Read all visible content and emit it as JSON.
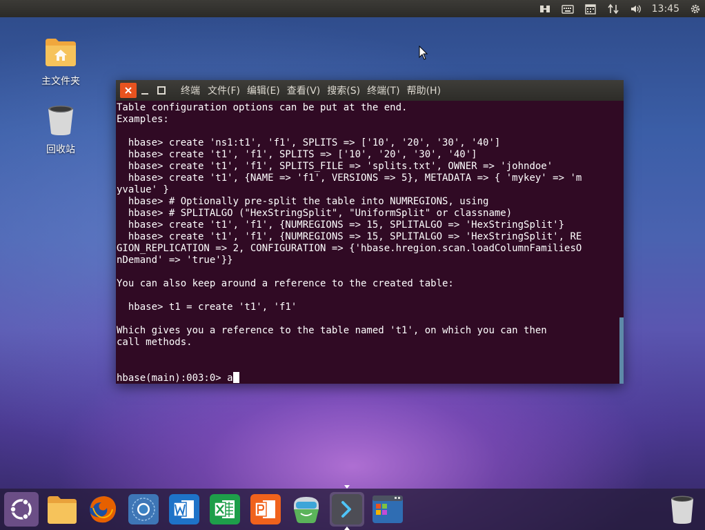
{
  "topbar": {
    "tray_icons": [
      "network-icon",
      "keyboard-icon",
      "calendar-icon",
      "transfer-icon",
      "volume-icon"
    ],
    "clock": "13:45",
    "power_icon": "gear-power-icon"
  },
  "desktop": {
    "icons": [
      {
        "name": "home-folder",
        "label": "主文件夹",
        "icon": "home-folder-icon"
      },
      {
        "name": "trash",
        "label": "回收站",
        "icon": "trash-icon"
      }
    ]
  },
  "terminal": {
    "title": "终端",
    "menus": [
      "文件(F)",
      "编辑(E)",
      "查看(V)",
      "搜索(S)",
      "终端(T)",
      "帮助(H)"
    ],
    "lines": [
      "Table configuration options can be put at the end.",
      "Examples:",
      "",
      "  hbase> create 'ns1:t1', 'f1', SPLITS => ['10', '20', '30', '40']",
      "  hbase> create 't1', 'f1', SPLITS => ['10', '20', '30', '40']",
      "  hbase> create 't1', 'f1', SPLITS_FILE => 'splits.txt', OWNER => 'johndoe'",
      "  hbase> create 't1', {NAME => 'f1', VERSIONS => 5}, METADATA => { 'mykey' => 'm",
      "yvalue' }",
      "  hbase> # Optionally pre-split the table into NUMREGIONS, using",
      "  hbase> # SPLITALGO (\"HexStringSplit\", \"UniformSplit\" or classname)",
      "  hbase> create 't1', 'f1', {NUMREGIONS => 15, SPLITALGO => 'HexStringSplit'}",
      "  hbase> create 't1', 'f1', {NUMREGIONS => 15, SPLITALGO => 'HexStringSplit', RE",
      "GION_REPLICATION => 2, CONFIGURATION => {'hbase.hregion.scan.loadColumnFamiliesO",
      "nDemand' => 'true'}}",
      "",
      "You can also keep around a reference to the created table:",
      "",
      "  hbase> t1 = create 't1', 'f1'",
      "",
      "Which gives you a reference to the table named 't1', on which you can then",
      "call methods.",
      "",
      ""
    ],
    "prompt": "hbase(main):003:0> ",
    "input": "a"
  },
  "dock": {
    "items": [
      {
        "name": "ubuntu-launcher",
        "icon": "ubuntu-logo-icon"
      },
      {
        "name": "files",
        "icon": "folder-icon"
      },
      {
        "name": "firefox",
        "icon": "firefox-icon"
      },
      {
        "name": "chromium",
        "icon": "chromium-icon"
      },
      {
        "name": "wps-writer",
        "icon": "word-icon"
      },
      {
        "name": "wps-spreadsheets",
        "icon": "excel-icon"
      },
      {
        "name": "wps-presentation",
        "icon": "powerpoint-icon"
      },
      {
        "name": "software-center",
        "icon": "software-center-icon"
      },
      {
        "name": "terminal",
        "icon": "terminal-icon",
        "active": true
      },
      {
        "name": "workspace-switcher",
        "icon": "workspace-icon"
      },
      {
        "name": "trash",
        "icon": "trash-icon"
      }
    ]
  },
  "colors": {
    "terminal_bg": "#300a24",
    "close_button": "#e8531f",
    "scrollbar": "#5e8aa8"
  }
}
